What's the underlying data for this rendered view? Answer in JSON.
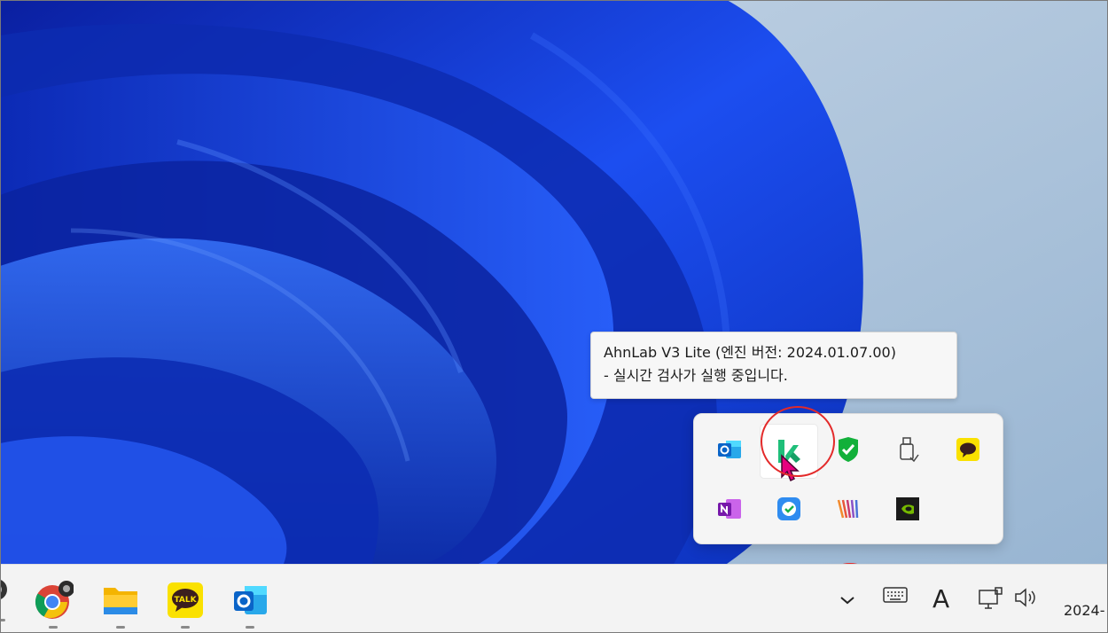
{
  "tooltip": {
    "line1": "AhnLab V3 Lite (엔진 버전: 2024.01.07.00)",
    "line2": "- 실시간 검사가 실행 중입니다."
  },
  "tray_overflow": {
    "icons": [
      "outlook-icon",
      "ahnlab-v3-icon",
      "shield-check-icon",
      "usb-device-icon",
      "kakaotalk-icon",
      "onenote-icon",
      "cloud-sync-icon",
      "bandizip-stripes-icon",
      "nvidia-icon"
    ],
    "hovered": "ahnlab-v3-icon"
  },
  "taskbar": {
    "apps": [
      "chrome-icon",
      "file-explorer-icon",
      "kakaotalk-icon",
      "outlook-icon"
    ],
    "kakaotalk_label": "TALK",
    "show_hidden_icons": "chevron-up-icon",
    "system_icons": [
      "keyboard-icon",
      "ime-icon",
      "network-icon",
      "volume-icon"
    ],
    "ime_label": "A",
    "clock_text": "2024-"
  },
  "colors": {
    "highlight_circle": "#e32a2a",
    "ahnlab_green": "#1fbf7a",
    "wallpaper_blue": "#1340d8",
    "wallpaper_bg": "#a9c1da"
  }
}
